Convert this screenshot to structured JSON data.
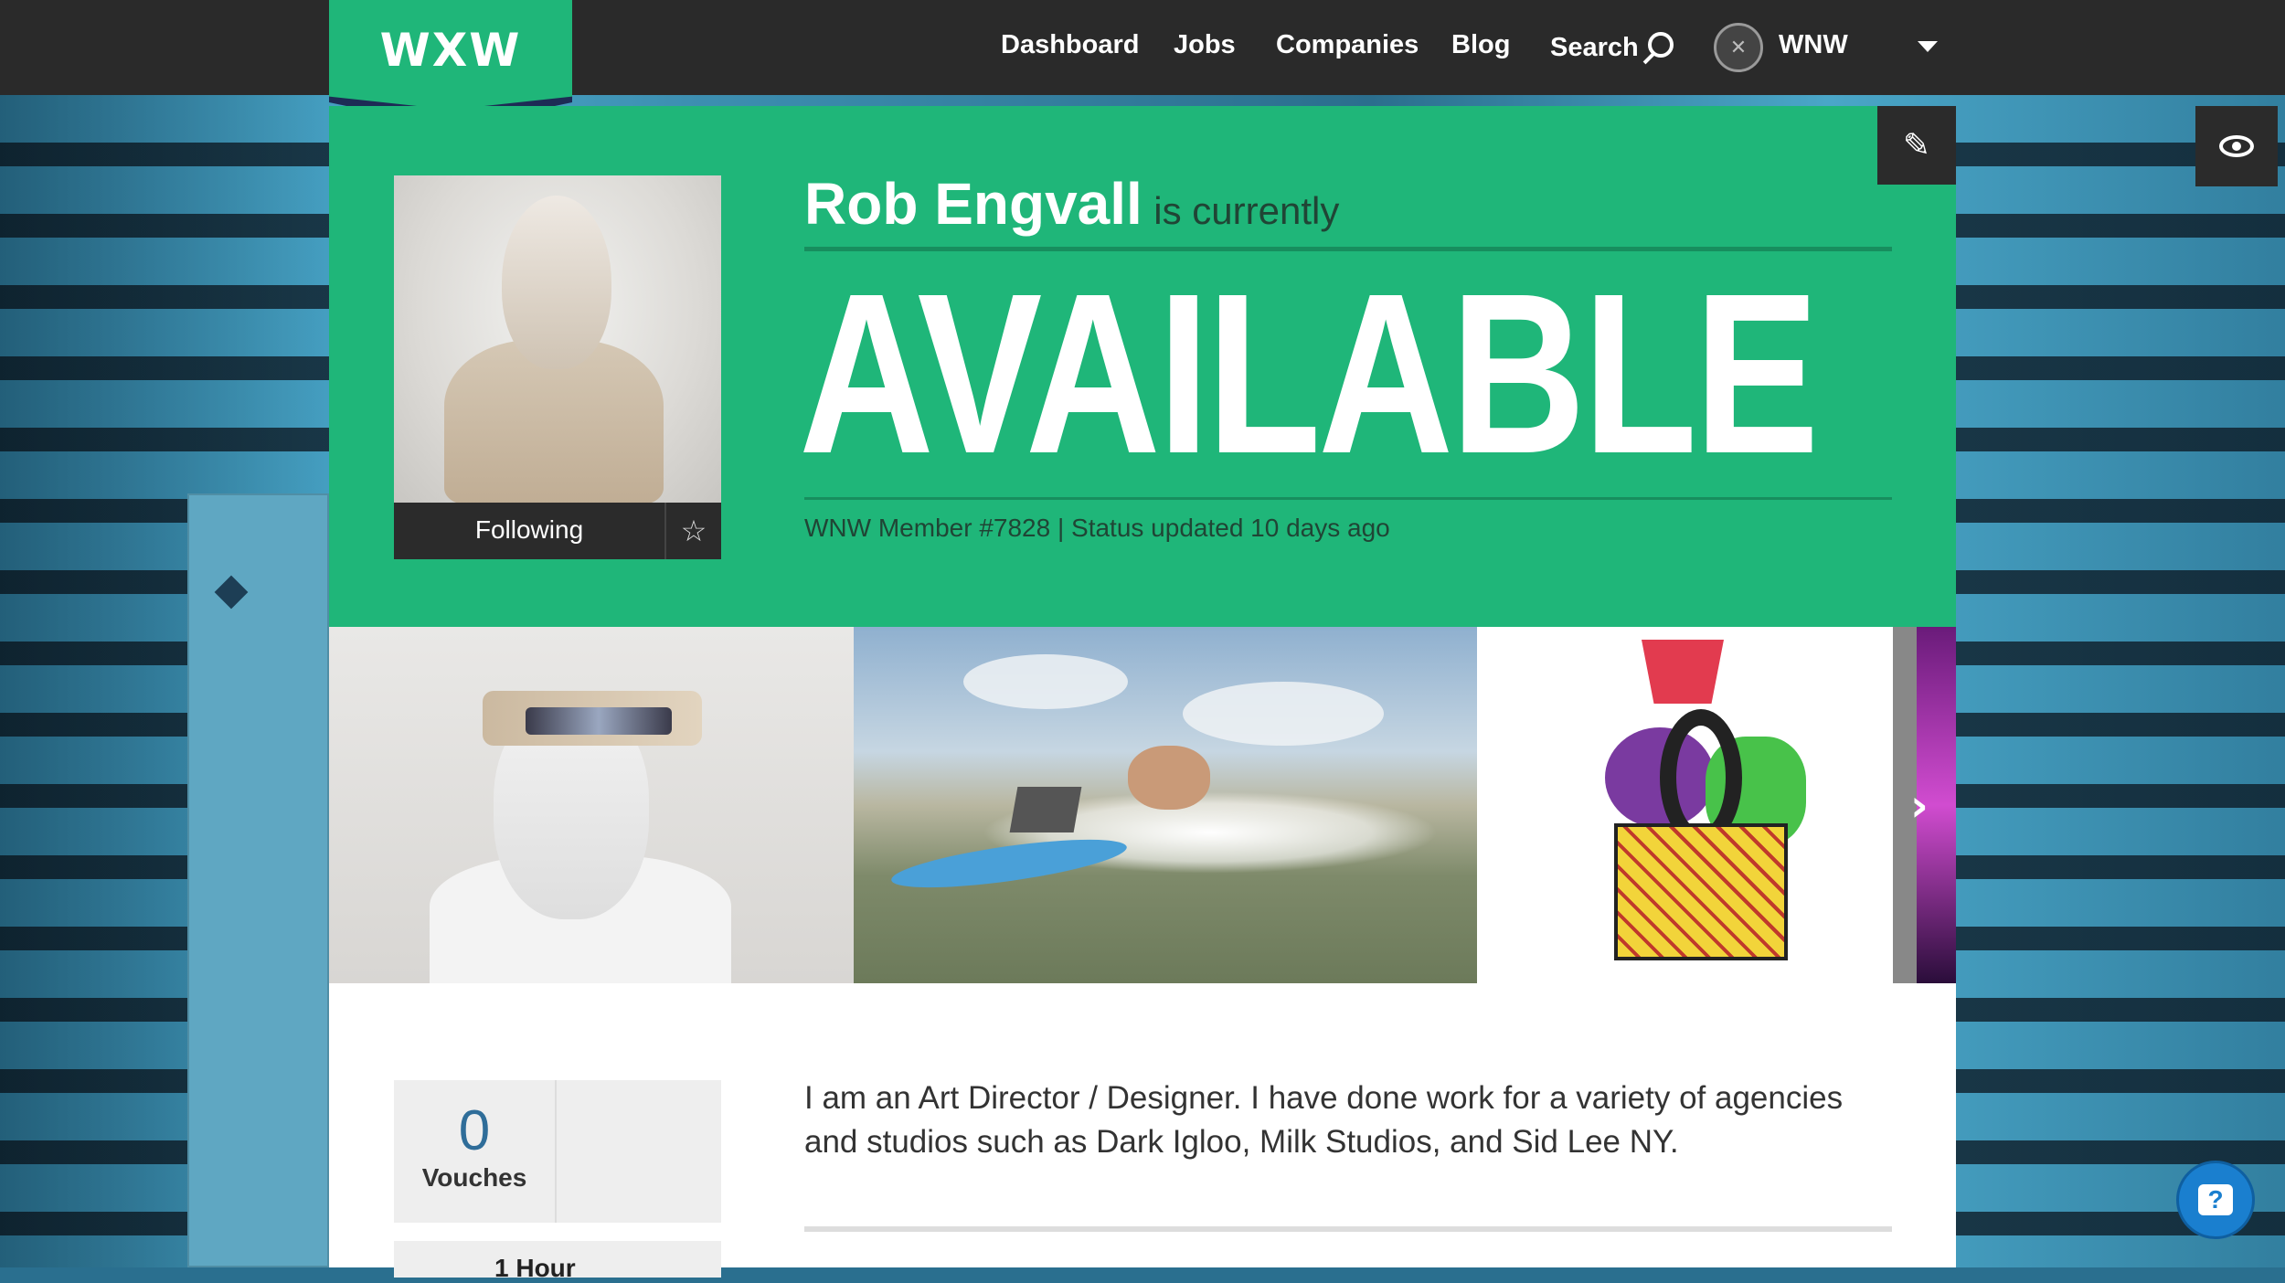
{
  "nav": {
    "logo": "WXW",
    "links": [
      "Dashboard",
      "Jobs",
      "Companies",
      "Blog"
    ],
    "search_label": "Search",
    "user_label": "WNW"
  },
  "profile": {
    "name": "Rob Engvall",
    "currently_label": "is currently",
    "status": "AVAILABLE",
    "member_line": "WNW Member #7828 | Status updated 10 days ago",
    "following_label": "Following"
  },
  "stats": {
    "vouches_count": "0",
    "vouches_label": "Vouches",
    "second_label": "1 Hour"
  },
  "bio": "I am an Art Director / Designer. I have done work for a variety of agencies and studios such as Dark Igloo, Milk Studios, and Sid Lee NY.",
  "colors": {
    "brand_green": "#1fb679",
    "dark": "#2a2a2a",
    "accent_blue": "#2f6d99"
  }
}
